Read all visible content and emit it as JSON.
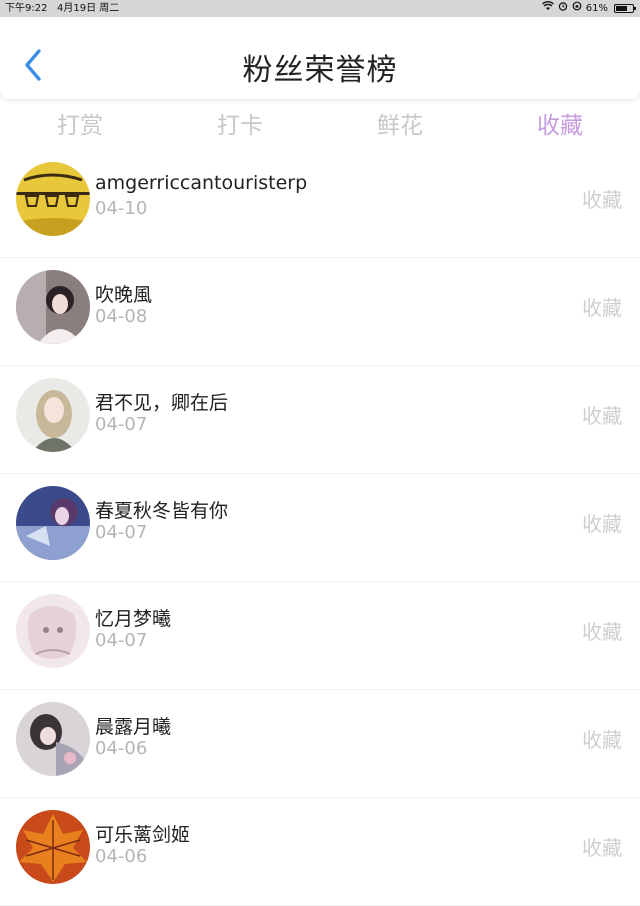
{
  "status_bar": {
    "time": "下午9:22",
    "date": "4月19日 周二",
    "battery": "61%",
    "battery_level": 0.61,
    "icons": [
      "wifi-icon",
      "alarm-icon",
      "orientation-lock-icon",
      "battery-icon"
    ]
  },
  "header": {
    "title": "粉丝荣誉榜",
    "back_icon": "chevron-left-icon",
    "accent_color": "#3a8ee6"
  },
  "tabs": [
    {
      "label": "打赏",
      "active": false
    },
    {
      "label": "打卡",
      "active": false
    },
    {
      "label": "鲜花",
      "active": false
    },
    {
      "label": "收藏",
      "active": true
    }
  ],
  "active_tab_color": "#c79be0",
  "fans": [
    {
      "name": "amgerriccantouristerp",
      "date": "04-10",
      "action": "收藏"
    },
    {
      "name": "吹晚風",
      "date": "04-08",
      "action": "收藏"
    },
    {
      "name": "君不见，卿在后",
      "date": "04-07",
      "action": "收藏"
    },
    {
      "name": "春夏秋冬皆有你",
      "date": "04-07",
      "action": "收藏"
    },
    {
      "name": "忆月梦曦",
      "date": "04-07",
      "action": "收藏"
    },
    {
      "name": "晨露月曦",
      "date": "04-06",
      "action": "收藏"
    },
    {
      "name": "可乐蓠剑姬",
      "date": "04-06",
      "action": "收藏"
    }
  ]
}
